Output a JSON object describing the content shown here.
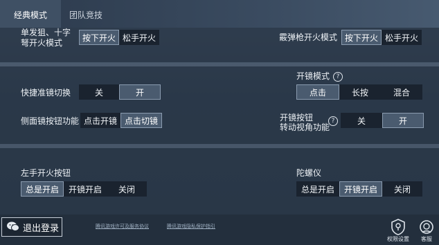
{
  "tabs": [
    {
      "label": "经典模式"
    },
    {
      "label": "团队竞技"
    }
  ],
  "fire_mode": {
    "left_label_1": "单发狙、十字",
    "left_label_2": "弩开火模式",
    "left_options": [
      "按下开火",
      "松手开火"
    ],
    "right_label": "霰弹枪开火模式",
    "right_options": [
      "按下开火",
      "松手开火"
    ]
  },
  "quick_scope": {
    "label": "快捷准镜切换",
    "options": [
      "关",
      "开"
    ]
  },
  "scope_mode": {
    "label": "开镜模式",
    "help": "?",
    "options": [
      "点击",
      "长按",
      "混合"
    ]
  },
  "side_scope": {
    "label": "侧面镜按钮功能",
    "options": [
      "点击开镜",
      "点击切镜"
    ]
  },
  "scope_btn_view": {
    "label_1": "开镜按钮",
    "label_2": "转动视角功能",
    "help": "?",
    "options": [
      "关",
      "开"
    ]
  },
  "left_fire": {
    "label": "左手开火按钮",
    "options": [
      "总是开启",
      "开镜开启",
      "关闭"
    ]
  },
  "gyro": {
    "label": "陀螺仪",
    "options": [
      "总是开启",
      "开镜开启",
      "关闭"
    ]
  },
  "footer": {
    "logout_label": "退出登录",
    "link_1": "腾讯游戏许可及服务协议",
    "link_2": "腾讯游戏隐私保护指引",
    "perm_label": "权限设置",
    "service_label": "客服"
  }
}
